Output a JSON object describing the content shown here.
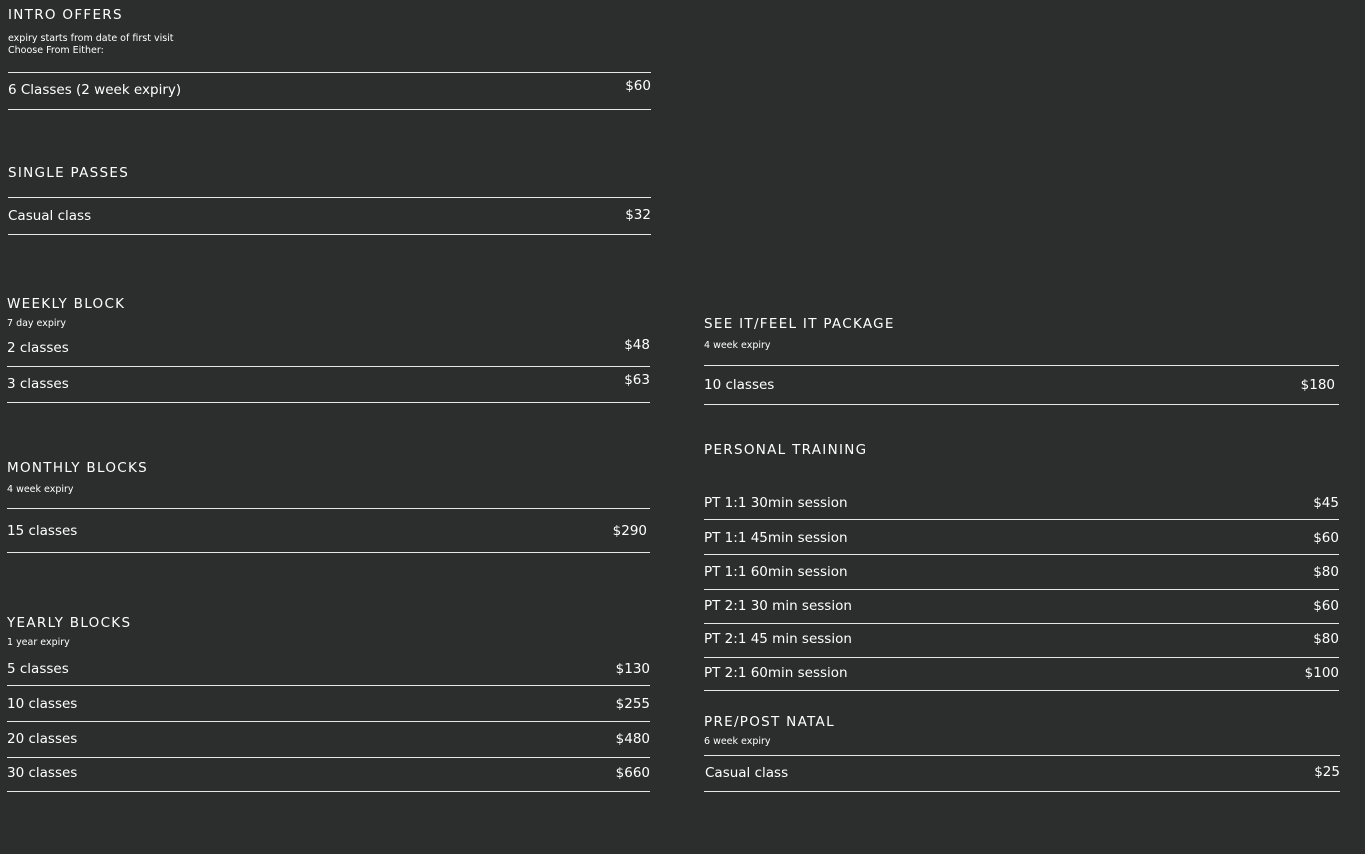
{
  "intro": {
    "title": "INTRO OFFERS",
    "note1": "expiry starts from date of first visit",
    "note2": "Choose From Either:",
    "items": [
      {
        "name": "6 Classes (2 week expiry)",
        "price": "$60"
      }
    ]
  },
  "single": {
    "title": "SINGLE PASSES",
    "items": [
      {
        "name": "Casual class",
        "price": "$32"
      }
    ]
  },
  "weekly": {
    "title": "WEEKLY BLOCK",
    "note": "7 day expiry",
    "items": [
      {
        "name": "2 classes",
        "price": "$48"
      },
      {
        "name": "3 classes",
        "price": "$63"
      }
    ]
  },
  "monthly": {
    "title": "MONTHLY BLOCKS",
    "note": "4 week  expiry",
    "items": [
      {
        "name": "15 classes",
        "price": "$290"
      }
    ]
  },
  "yearly": {
    "title": "YEARLY BLOCKS",
    "note": "1 year expiry",
    "items": [
      {
        "name": "5 classes",
        "price": "$130"
      },
      {
        "name": "10 classes",
        "price": "$255"
      },
      {
        "name": "20 classes",
        "price": "$480"
      },
      {
        "name": "30 classes",
        "price": "$660"
      }
    ]
  },
  "seeit": {
    "title": "SEE IT/FEEL IT PACKAGE",
    "note": "4 week expiry",
    "items": [
      {
        "name": "10 classes",
        "price": "$180"
      }
    ]
  },
  "pt": {
    "title": "PERSONAL TRAINING",
    "items": [
      {
        "name": "PT 1:1 30min session",
        "price": "$45"
      },
      {
        "name": "PT 1:1 45min session",
        "price": "$60"
      },
      {
        "name": "PT 1:1 60min session",
        "price": "$80"
      },
      {
        "name": "PT 2:1 30 min session",
        "price": "$60"
      },
      {
        "name": "PT 2:1 45 min session",
        "price": "$80"
      },
      {
        "name": "PT 2:1 60min session",
        "price": "$100"
      }
    ]
  },
  "natal": {
    "title": "PRE/POST NATAL",
    "note": "6 week expiry",
    "items": [
      {
        "name": "Casual class",
        "price": "$25"
      }
    ]
  }
}
